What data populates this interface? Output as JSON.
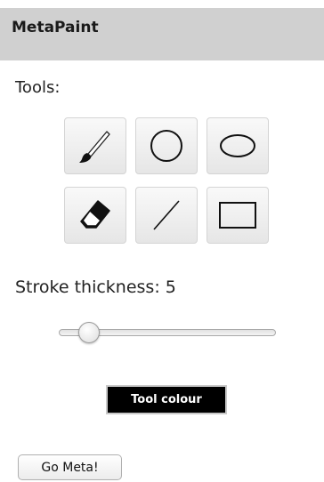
{
  "header": {
    "title": "MetaPaint"
  },
  "tools": {
    "label": "Tools:",
    "items": [
      {
        "name": "brush",
        "icon": "brush-icon"
      },
      {
        "name": "circle",
        "icon": "circle-icon"
      },
      {
        "name": "ellipse",
        "icon": "ellipse-icon"
      },
      {
        "name": "eraser",
        "icon": "eraser-icon"
      },
      {
        "name": "line",
        "icon": "line-icon"
      },
      {
        "name": "rectangle",
        "icon": "rectangle-icon"
      }
    ]
  },
  "stroke": {
    "label": "Stroke thickness:",
    "value": "5",
    "slider_fraction": 0.1
  },
  "colour_button": {
    "label": "Tool colour",
    "background": "#000000",
    "text_color": "#ffffff"
  },
  "meta_button": {
    "label": "Go Meta!"
  },
  "colors": {
    "header_background": "#d0d0d0"
  }
}
